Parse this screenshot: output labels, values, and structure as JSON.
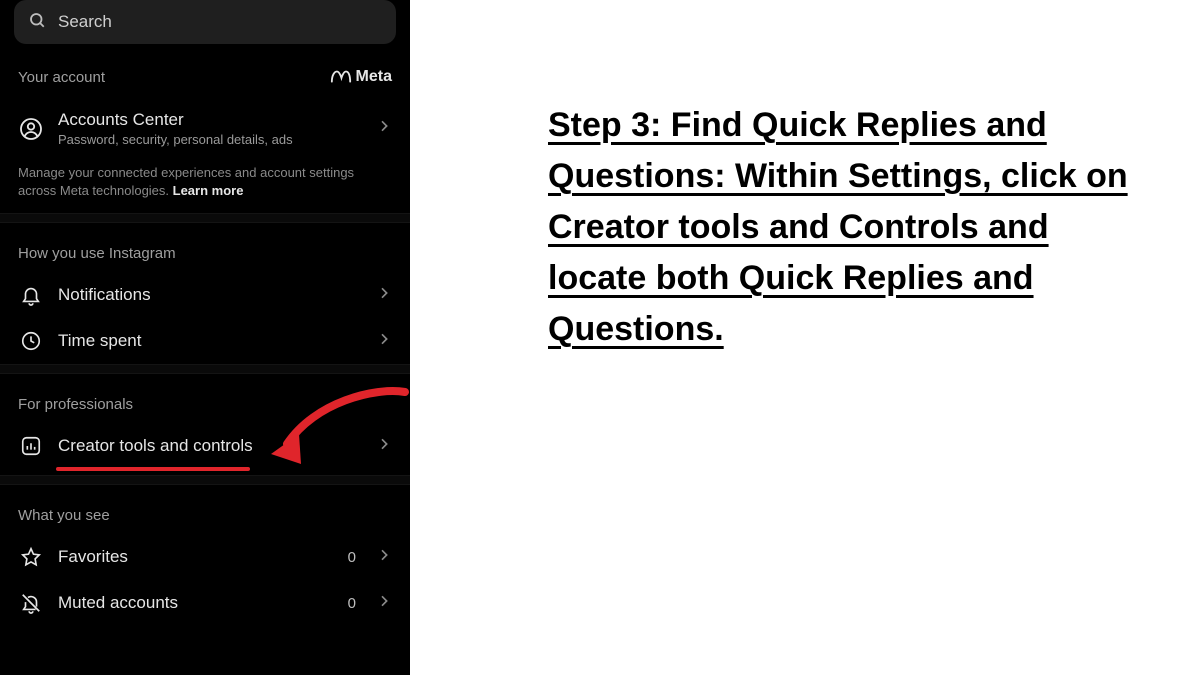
{
  "instruction_text": "Step 3: Find Quick Replies and Questions: Within Settings, click on Creator tools and Controls and locate both Quick Replies and Questions.",
  "search": {
    "placeholder": "Search"
  },
  "brand": {
    "name": "Meta"
  },
  "sections": {
    "account": {
      "heading": "Your account",
      "item": {
        "title": "Accounts Center",
        "subtitle": "Password, security, personal details, ads"
      },
      "description_prefix": "Manage your connected experiences and account settings across Meta technologies. ",
      "learn_more": "Learn more"
    },
    "usage": {
      "heading": "How you use Instagram",
      "notifications": "Notifications",
      "time_spent": "Time spent"
    },
    "pro": {
      "heading": "For professionals",
      "creator_tools": "Creator tools and controls"
    },
    "see": {
      "heading": "What you see",
      "favorites": "Favorites",
      "favorites_count": "0",
      "muted": "Muted accounts",
      "muted_count": "0"
    }
  }
}
